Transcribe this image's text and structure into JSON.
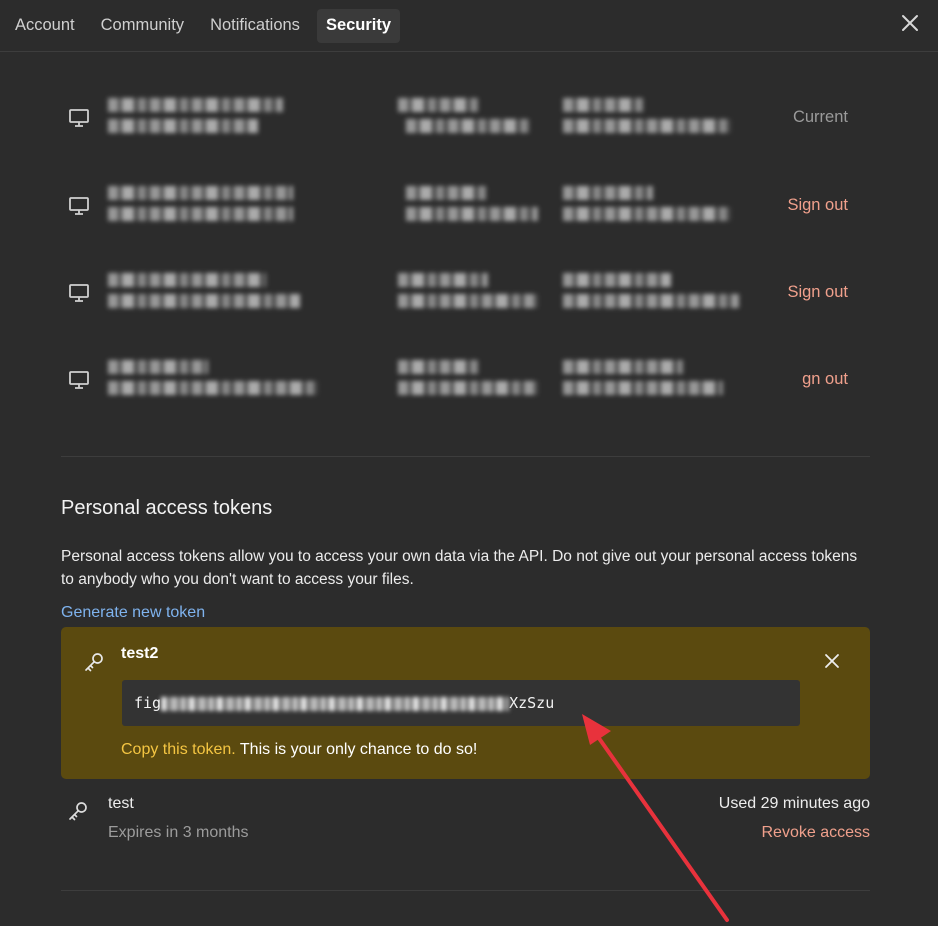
{
  "tabs": [
    {
      "label": "Account",
      "active": false
    },
    {
      "label": "Community",
      "active": false
    },
    {
      "label": "Notifications",
      "active": false
    },
    {
      "label": "Security",
      "active": true
    }
  ],
  "sessions": [
    {
      "status": "Current",
      "type": "current"
    },
    {
      "status": "Sign out",
      "type": "signout"
    },
    {
      "status": "Sign out",
      "type": "signout"
    },
    {
      "status": "gn out",
      "type": "signout"
    }
  ],
  "pat": {
    "title": "Personal access tokens",
    "description": "Personal access tokens allow you to access your own data via the API. Do not give out your personal access tokens to anybody who you don't want to access your files.",
    "generate_label": "Generate new token",
    "new_token": {
      "name": "test2",
      "value_prefix": "fig",
      "value_suffix": "XzSzu",
      "copy_highlight": "Copy this token.",
      "copy_rest": " This is your only chance to do so!"
    },
    "tokens": [
      {
        "name": "test",
        "expires": "Expires in 3 months",
        "used": "Used 29 minutes ago",
        "revoke_label": "Revoke access"
      }
    ]
  },
  "colors": {
    "background": "#2c2c2c",
    "token_highlight_bg": "#5b4a0f",
    "link": "#7fb3ee",
    "danger": "#f0a08c",
    "warning_text": "#f4c542",
    "annotation_arrow": "#e8323c"
  },
  "icons": {
    "close": "close-icon",
    "device": "monitor-icon",
    "key": "key-icon"
  }
}
